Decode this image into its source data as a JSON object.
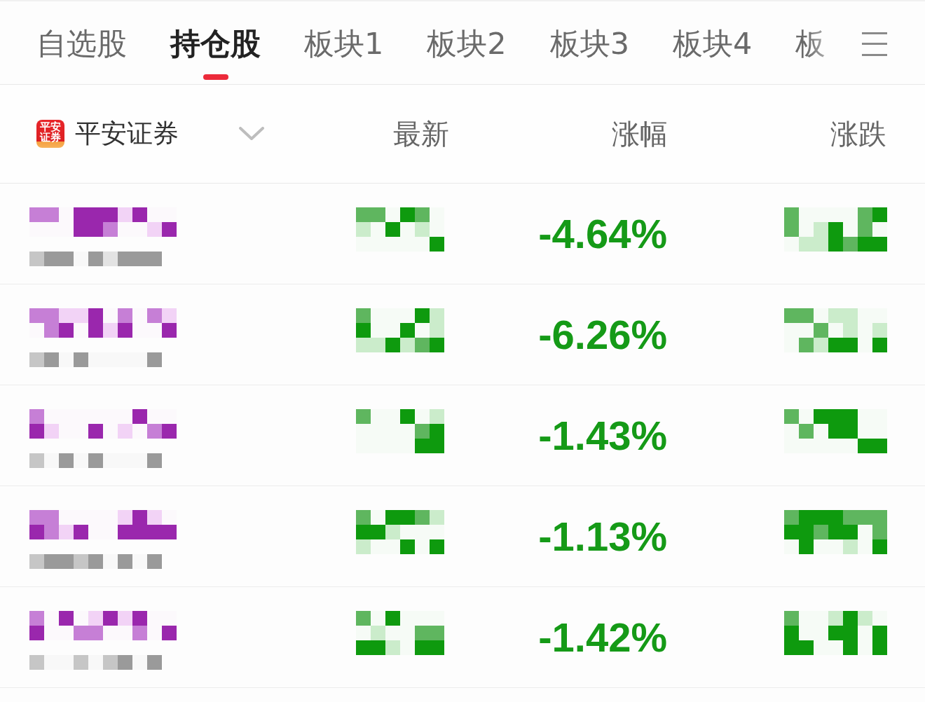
{
  "tabs": [
    {
      "label": "自选股",
      "selected": false
    },
    {
      "label": "持仓股",
      "selected": true
    },
    {
      "label": "板块1",
      "selected": false
    },
    {
      "label": "板块2",
      "selected": false
    },
    {
      "label": "板块3",
      "selected": false
    },
    {
      "label": "板块4",
      "selected": false
    },
    {
      "label": "板",
      "selected": false
    }
  ],
  "broker": {
    "logo_text": "平安证券",
    "name": "平安证券"
  },
  "columns": [
    "最新",
    "涨幅",
    "涨跌"
  ],
  "rows": [
    {
      "change_percent": "-4.64%",
      "falling": true
    },
    {
      "change_percent": "-6.26%",
      "falling": true
    },
    {
      "change_percent": "-1.43%",
      "falling": true
    },
    {
      "change_percent": "-1.13%",
      "falling": true
    },
    {
      "change_percent": "-1.42%",
      "falling": true
    }
  ]
}
